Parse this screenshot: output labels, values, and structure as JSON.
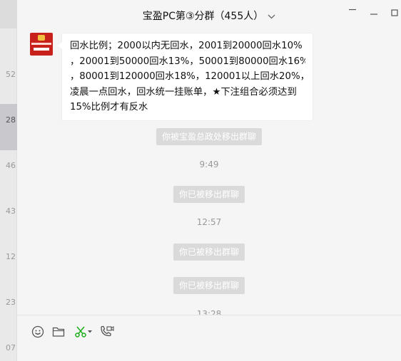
{
  "window": {
    "title": "宝盈PC第③分群（455人）",
    "controls": [
      "pin",
      "minimize",
      "maximize",
      "close"
    ]
  },
  "sidebar": {
    "time_fragments": [
      "52",
      "28",
      "46",
      "43",
      "12",
      "23",
      "07"
    ]
  },
  "messages": {
    "first": {
      "avatar_icon": "bot-avatar",
      "lines": [
        "回水比例；2000以内无回水，2001到20000回水10%",
        "，20001到50000回水13%，50001到80000回水16%",
        "，80001到120000回水18%，120001以上回水20%，",
        "凌晨一点回水，回水统一挂账单，★下注组合必须达到",
        "15%比例才有反水"
      ]
    },
    "system_1": "你被宝盈总政处移出群聊",
    "time_1": "9:49",
    "system_2": "你已被移出群聊",
    "time_2": "12:57",
    "system_3": "你已被移出群聊",
    "system_4": "你已被移出群聊",
    "time_3": "13:28"
  },
  "toolbar": {
    "icons": [
      "emoji-icon",
      "folder-icon",
      "scissors-icon",
      "video-call-icon"
    ],
    "scissors_color": "#1aad19"
  }
}
